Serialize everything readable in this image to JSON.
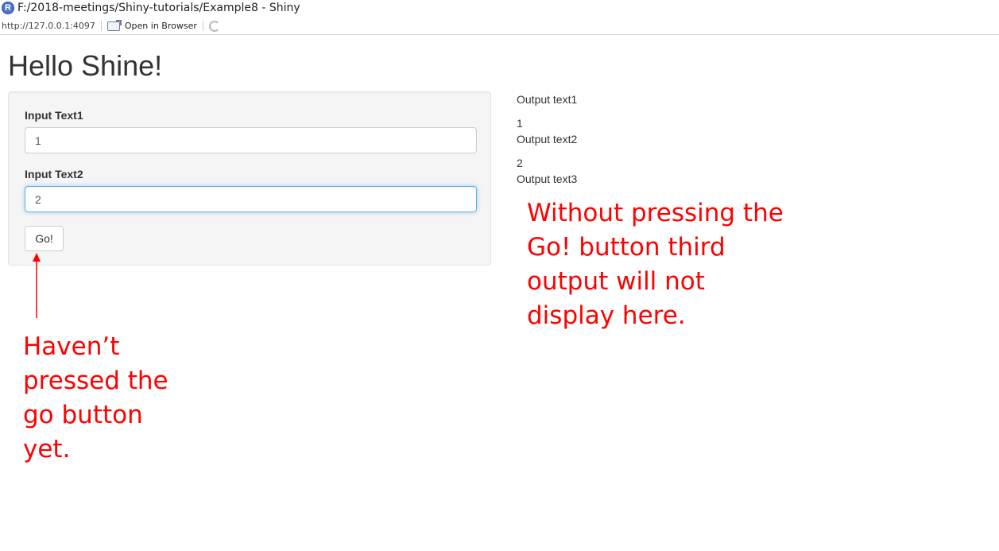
{
  "window": {
    "title": "F:/2018-meetings/Shiny-tutorials/Example8 - Shiny",
    "logo_letter": "R"
  },
  "toolbar": {
    "url": "http://127.0.0.1:4097",
    "open_in_browser": "Open in Browser",
    "icons": [
      "popout-icon",
      "refresh-icon"
    ]
  },
  "app": {
    "title": "Hello Shine!",
    "inputs": [
      {
        "label": "Input Text1",
        "value": "1"
      },
      {
        "label": "Input Text2",
        "value": "2"
      }
    ],
    "go_label": "Go!",
    "outputs": [
      {
        "label": "Output text1",
        "value": "1"
      },
      {
        "label": "Output text2",
        "value": "2"
      },
      {
        "label": "Output text3",
        "value": ""
      }
    ]
  },
  "annotations": {
    "right": "Without pressing the Go! button third output will not display here.",
    "left": "Haven’t pressed the go button yet.",
    "color": "#ff0000"
  },
  "colors": {
    "focus_border": "#66afe9",
    "well_background": "#f5f5f5"
  }
}
